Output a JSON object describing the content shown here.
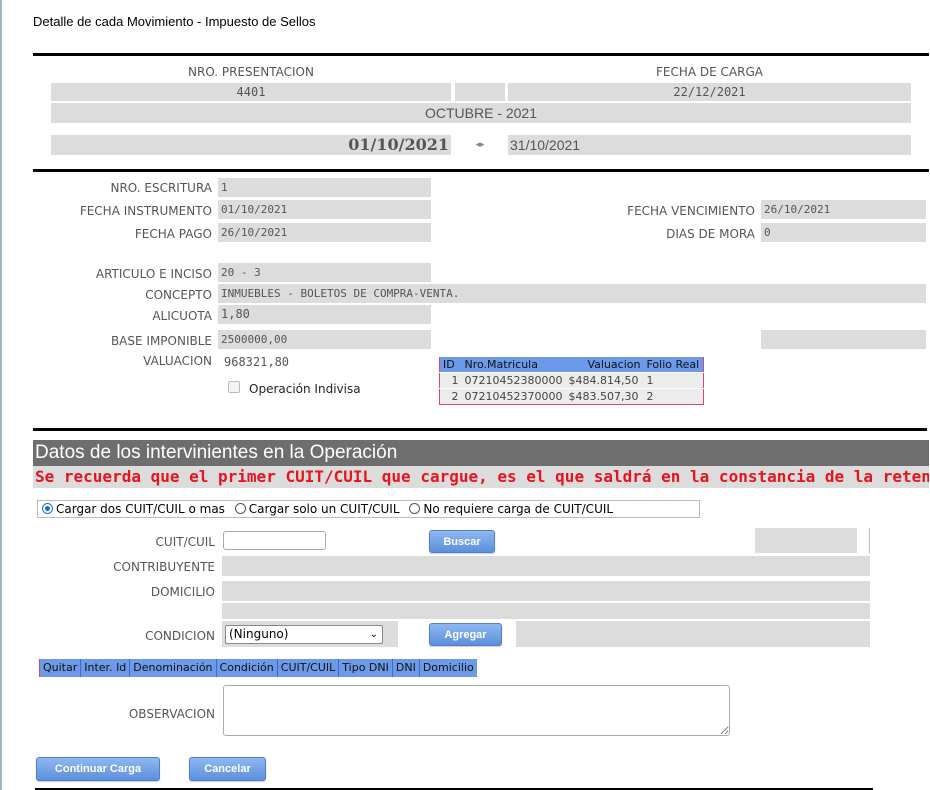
{
  "page_title": "Detalle de cada Movimiento - Impuesto de Sellos",
  "header": {
    "nro_presentacion_label": "NRO. PRESENTACION",
    "nro_presentacion": "4401",
    "fecha_carga_label": "FECHA DE CARGA",
    "fecha_carga": "22/12/2021",
    "periodo": "OCTUBRE - 2021",
    "fecha_desde": "01/10/2021",
    "fecha_hasta": "31/10/2021"
  },
  "details": {
    "nro_escritura_label": "NRO. ESCRITURA",
    "nro_escritura": "1",
    "fecha_instrumento_label": "FECHA INSTRUMENTO",
    "fecha_instrumento": "01/10/2021",
    "fecha_vencimiento_label": "FECHA VENCIMIENTO",
    "fecha_vencimiento": "26/10/2021",
    "fecha_pago_label": "FECHA PAGO",
    "fecha_pago": "26/10/2021",
    "dias_mora_label": "DIAS DE MORA",
    "dias_mora": "0",
    "articulo_label": "ARTICULO E INCISO",
    "articulo": "20 - 3",
    "concepto_label": "CONCEPTO",
    "concepto": "INMUEBLES - BOLETOS DE COMPRA-VENTA.",
    "alicuota_label": "ALICUOTA",
    "alicuota": "1,80",
    "base_label": "BASE IMPONIBLE",
    "base": "2500000,00",
    "valuacion_label": "VALUACION",
    "valuacion": "968321,80",
    "indivisa_label": "Operación Indivisa"
  },
  "matriculas": {
    "headers": [
      "ID",
      "Nro.Matricula",
      "Valuacion",
      "Folio Real"
    ],
    "rows": [
      [
        "1",
        "07210452380000",
        "$484.814,50",
        "1"
      ],
      [
        "2",
        "07210452370000",
        "$483.507,30",
        "2"
      ]
    ]
  },
  "intervinientes": {
    "section_title": "Datos de los intervinientes en la Operación",
    "warning": "Se recuerda que el primer CUIT/CUIL que cargue, es el que saldrá en la constancia de la retención.",
    "radio_options": [
      "Cargar dos CUIT/CUIL o mas",
      "Cargar solo un CUIT/CUIL",
      "No requiere carga de CUIT/CUIL"
    ],
    "cuit_label": "CUIT/CUIL",
    "cuit_value": "",
    "buscar_label": "Buscar",
    "contribuyente_label": "CONTRIBUYENTE",
    "domicilio_label": "DOMICILIO",
    "condicion_label": "CONDICION",
    "condicion_selected": "(Ninguno)",
    "agregar_label": "Agregar",
    "table_headers": [
      "Quitar",
      "Inter. Id",
      "Denominación",
      "Condición",
      "CUIT/CUIL",
      "Tipo DNI",
      "DNI",
      "Domicilio"
    ],
    "observacion_label": "OBSERVACION",
    "observacion_value": ""
  },
  "actions": {
    "continuar_label": "Continuar Carga",
    "cancelar_label": "Cancelar"
  },
  "colors": {
    "accent_button": "#5b8fdc",
    "table_header": "#6c9ae8",
    "warning": "#e8141c",
    "field_bg": "#dcdcdc",
    "section_bar": "#6e6e6e"
  }
}
